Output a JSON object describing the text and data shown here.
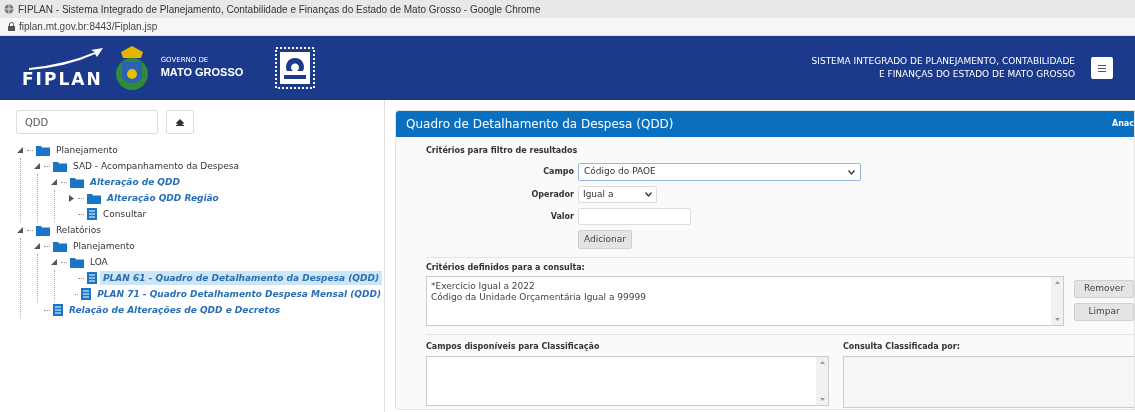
{
  "browser": {
    "title": "FIPLAN - Sistema Integrado de Planejamento, Contabilidade e Finanças do Estado de Mato Grosso - Google Chrome",
    "url": "fiplan.mt.gov.br:8443/Fiplan.jsp"
  },
  "header": {
    "logo": "FIPLAN",
    "gov_small": "GOVERNO DE",
    "gov_large": "MATO GROSSO",
    "system_name_1": "SISTEMA INTEGRADO DE PLANEJAMENTO, CONTABILIDADE",
    "system_name_2": "E FINANÇAS DO ESTADO DE MATO GROSSO"
  },
  "sidebar": {
    "search": {
      "value": "QDD"
    },
    "tree": [
      {
        "label": "Planejamento",
        "kind": "folder",
        "link": false,
        "expanded": true,
        "selected": false,
        "children": [
          {
            "label": "SAD - Acompanhamento da Despesa",
            "kind": "folder",
            "link": false,
            "expanded": true,
            "selected": false,
            "children": [
              {
                "label": "Alteração de QDD",
                "kind": "folder",
                "link": true,
                "expanded": true,
                "selected": false,
                "children": [
                  {
                    "label": "Alteração QDD Região",
                    "kind": "folder",
                    "link": true,
                    "expanded": false,
                    "selected": false
                  },
                  {
                    "label": "Consultar",
                    "kind": "page",
                    "link": false,
                    "selected": false
                  }
                ]
              }
            ]
          }
        ]
      },
      {
        "label": "Relatórios",
        "kind": "folder",
        "link": false,
        "expanded": true,
        "selected": false,
        "children": [
          {
            "label": "Planejamento",
            "kind": "folder",
            "link": false,
            "expanded": true,
            "selected": false,
            "children": [
              {
                "label": "LOA",
                "kind": "folder",
                "link": false,
                "expanded": true,
                "selected": false,
                "children": [
                  {
                    "label": "PLAN 61 - Quadro de Detalhamento da Despesa (QDD)",
                    "kind": "page",
                    "link": true,
                    "selected": true
                  },
                  {
                    "label": "PLAN 71 - Quadro Detalhamento Despesa Mensal (QDD)",
                    "kind": "page",
                    "link": true,
                    "selected": false
                  }
                ]
              }
            ]
          },
          {
            "label": "Relação de Alterações de QDD e Decretos",
            "kind": "page",
            "link": true,
            "selected": false
          }
        ]
      }
    ]
  },
  "panel": {
    "title": "Quadro de Detalhamento da Despesa (QDD)",
    "right_text": "Anac",
    "filter": {
      "heading": "Critérios para filtro de resultados",
      "campo_label": "Campo",
      "campo_value": "Código do PAOE",
      "operador_label": "Operador",
      "operador_value": "Igual a",
      "valor_label": "Valor",
      "add_button": "Adicionar"
    },
    "criteria": {
      "heading": "Critérios definidos para a consulta:",
      "lines": [
        "*Exercício Igual a 2022",
        "Código da Unidade Orçamentária Igual a 99999"
      ],
      "buttons": [
        "Remover",
        "Limpar"
      ]
    },
    "available": {
      "heading": "Campos disponíveis para Classificação"
    },
    "sorted": {
      "heading": "Consulta Classificada por:"
    }
  }
}
